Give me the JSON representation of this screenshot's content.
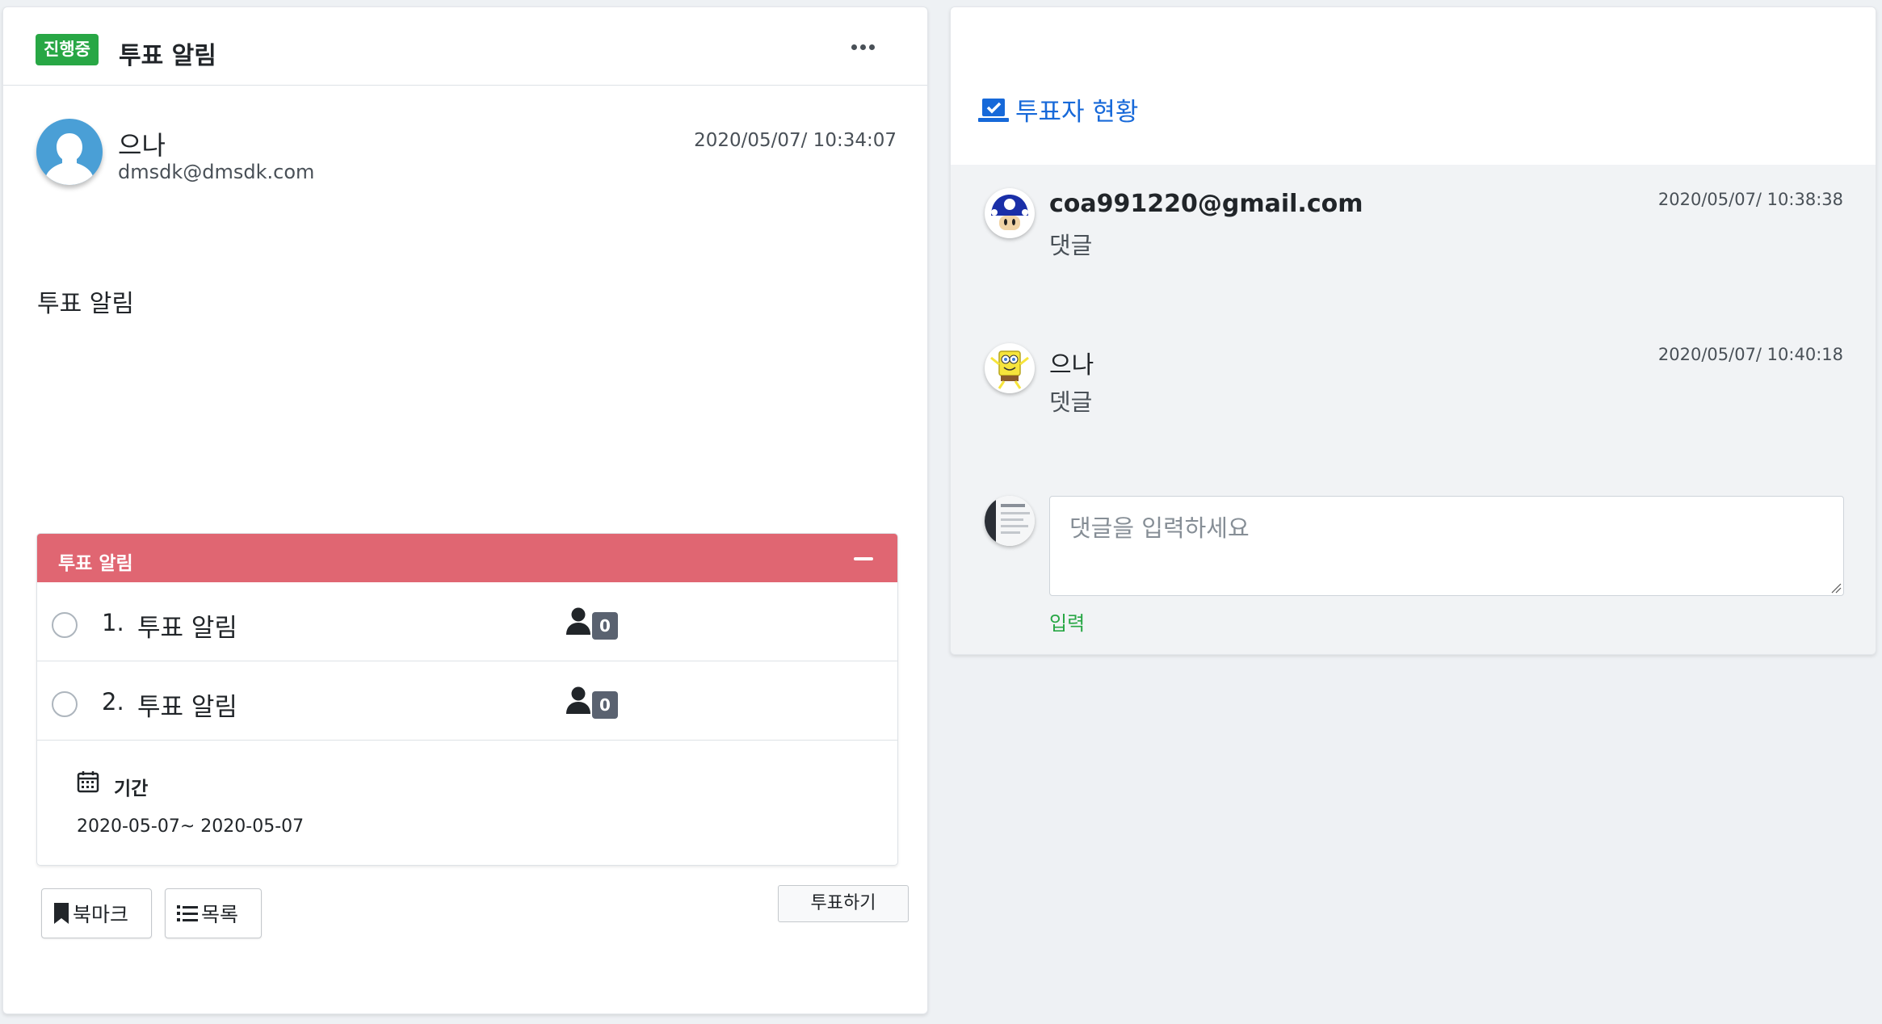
{
  "post": {
    "status_badge": "진행중",
    "title": "투표 알림",
    "author_name": "으나",
    "author_email": "dmsdk@dmsdk.com",
    "date": "2020/05/07/ 10:34:07",
    "body": "투표 알림"
  },
  "vote": {
    "title": "투표 알림",
    "options": [
      {
        "number": "1.",
        "label": "투표 알림",
        "count": "0"
      },
      {
        "number": "2.",
        "label": "투표 알림",
        "count": "0"
      }
    ],
    "period_label": "기간",
    "period_range": "2020-05-07~ 2020-05-07"
  },
  "buttons": {
    "bookmark": "북마크",
    "list": "목록",
    "vote": "투표하기"
  },
  "voters_panel": {
    "title": "투표자 현황",
    "comments": [
      {
        "author": "coa991220@gmail.com",
        "text": "댓글",
        "date": "2020/05/07/ 10:38:38"
      },
      {
        "author": "으나",
        "text": "뎃글",
        "date": "2020/05/07/ 10:40:18"
      }
    ],
    "input_placeholder": "댓글을 입력하세요",
    "submit_label": "입력"
  },
  "colors": {
    "status_green": "#28a745",
    "vote_header": "#e06672",
    "link_blue": "#1769d9",
    "badge_gray": "#5a6270"
  },
  "icons": [
    "more-icon",
    "user-icon",
    "calendar-icon",
    "bookmark-icon",
    "list-icon",
    "vote-check-icon"
  ]
}
